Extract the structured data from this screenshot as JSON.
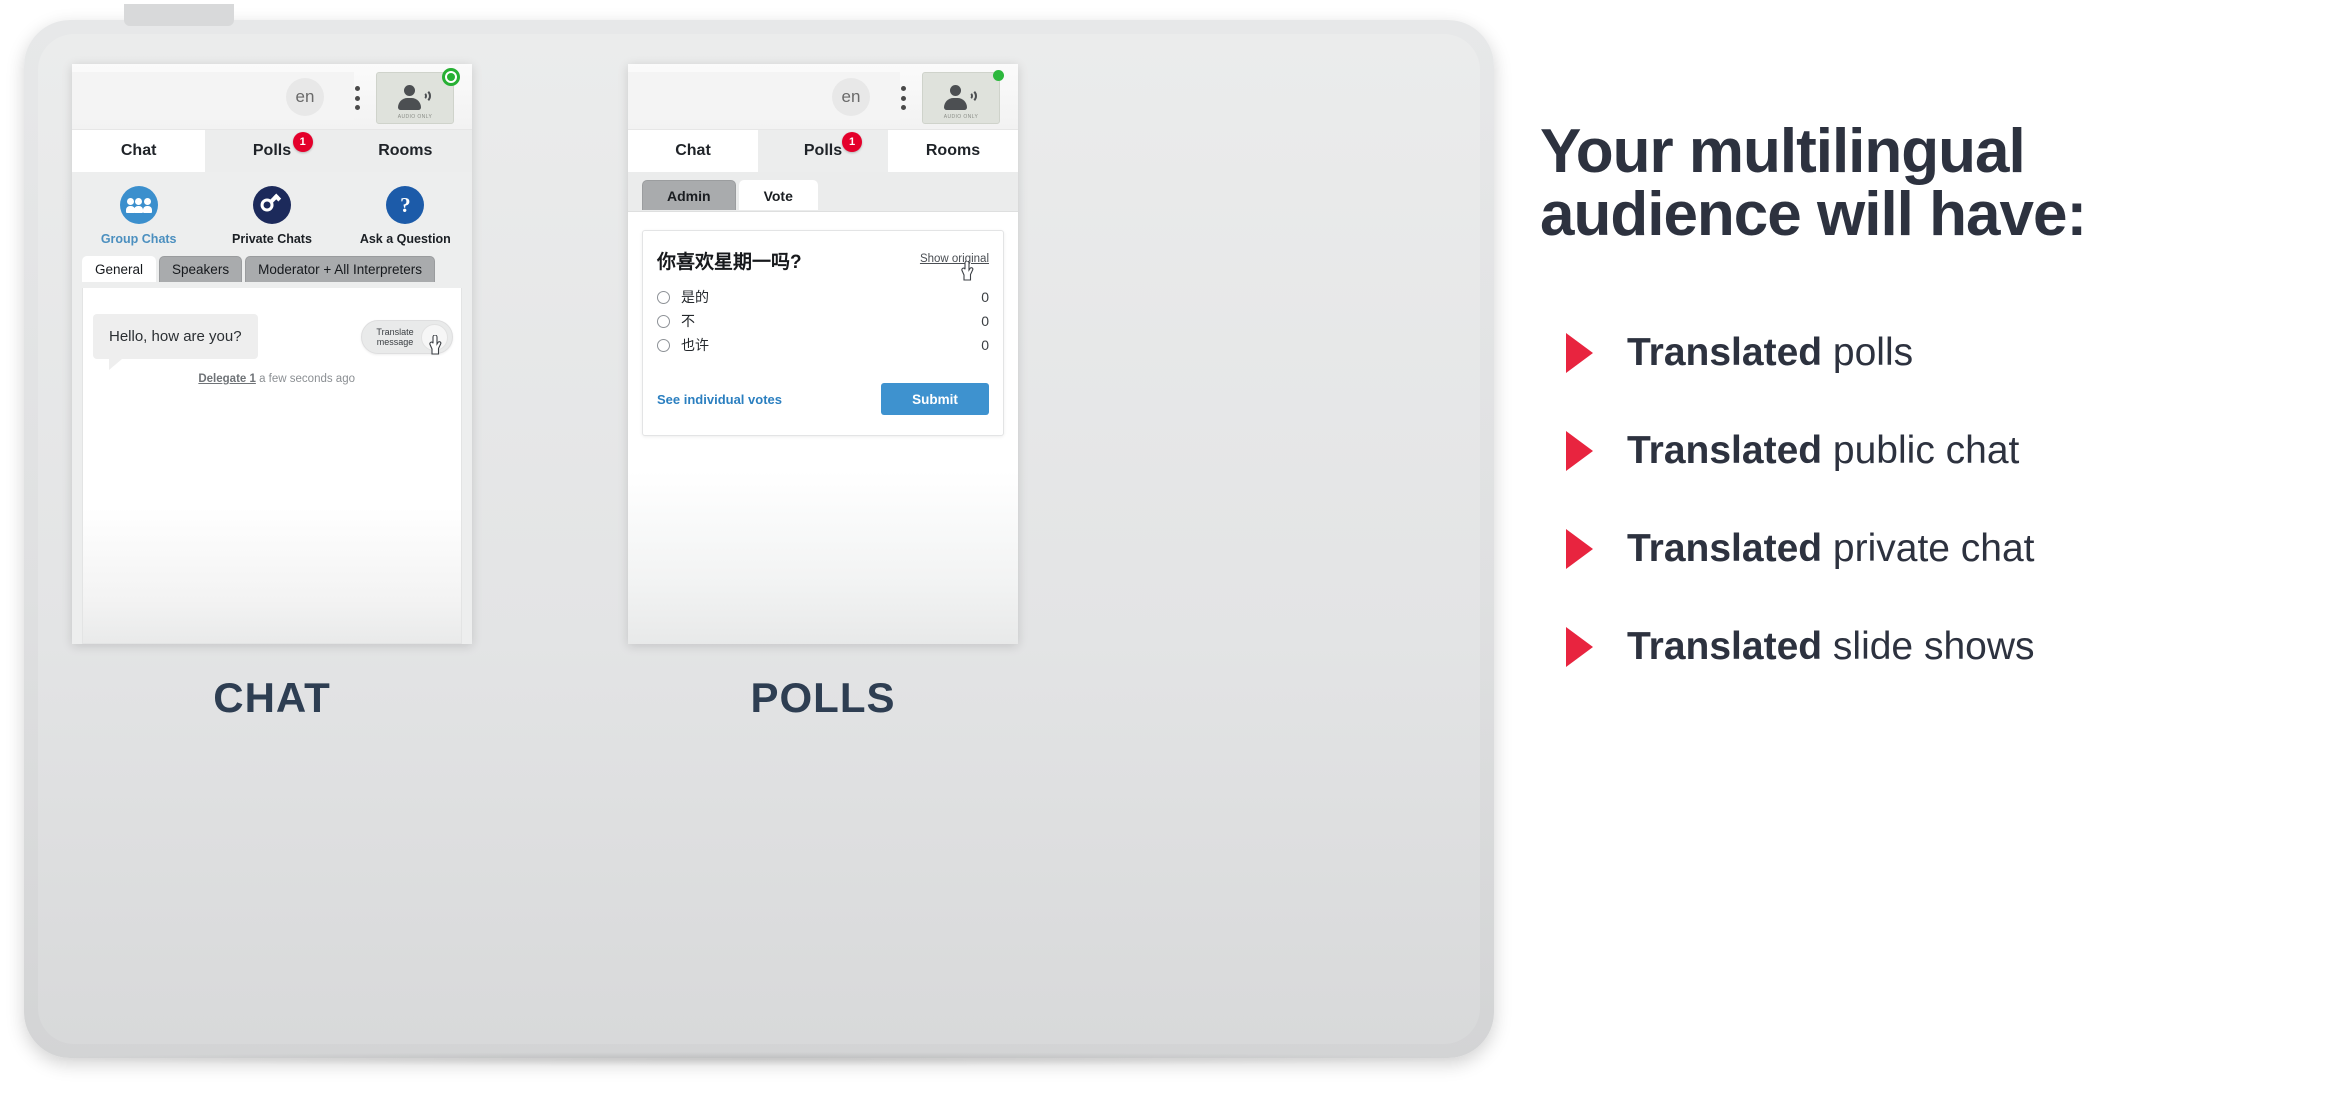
{
  "chat_app": {
    "topbar": {
      "language": "en",
      "menu_icon": "kebab-menu-icon",
      "audio_tile_label": "AUDIO ONLY",
      "status": "online"
    },
    "tabs": [
      {
        "label": "Chat",
        "active": true,
        "badge": ""
      },
      {
        "label": "Polls",
        "active": false,
        "badge": "1"
      },
      {
        "label": "Rooms",
        "active": false,
        "badge": ""
      }
    ],
    "actions": [
      {
        "label": "Group Chats",
        "icon": "group-people-icon"
      },
      {
        "label": "Private Chats",
        "icon": "key-icon"
      },
      {
        "label": "Ask a Question",
        "icon": "question-mark-icon"
      }
    ],
    "subtabs": [
      {
        "label": "General",
        "active": true
      },
      {
        "label": "Speakers",
        "active": false
      },
      {
        "label": "Moderator + All Interpreters",
        "active": false
      }
    ],
    "message": {
      "text": "Hello, how are you?",
      "author": "Delegate 1",
      "time": "a few seconds ago",
      "translate_line1": "Translate",
      "translate_line2": "message"
    },
    "caption": "CHAT"
  },
  "polls_app": {
    "topbar": {
      "language": "en",
      "menu_icon": "kebab-menu-icon",
      "audio_tile_label": "AUDIO ONLY",
      "status": "online"
    },
    "tabs": [
      {
        "label": "Chat",
        "active": false,
        "badge": ""
      },
      {
        "label": "Polls",
        "active": true,
        "badge": "1"
      },
      {
        "label": "Rooms",
        "active": false,
        "badge": ""
      }
    ],
    "subtabs": [
      {
        "label": "Admin",
        "active": false
      },
      {
        "label": "Vote",
        "active": true
      }
    ],
    "poll": {
      "question": "你喜欢星期一吗?",
      "show_original": "Show original",
      "options": [
        {
          "label": "是的",
          "votes": "0"
        },
        {
          "label": "不",
          "votes": "0"
        },
        {
          "label": "也许",
          "votes": "0"
        }
      ],
      "see_individual_votes": "See individual votes",
      "submit": "Submit"
    },
    "caption": "POLLS"
  },
  "promo": {
    "title_line1": "Your multilingual",
    "title_line2": "audience will have:",
    "items": [
      {
        "bold": "Translated",
        "rest": " polls"
      },
      {
        "bold": "Translated",
        "rest": " public chat"
      },
      {
        "bold": "Translated",
        "rest": " private chat"
      },
      {
        "bold": "Translated",
        "rest": " slide shows"
      }
    ]
  },
  "colors": {
    "accent_red": "#e8243f",
    "badge_red": "#e4002b",
    "brand_blue": "#3e92cf",
    "link_blue": "#2b7fc0",
    "dark_navy": "#2d323f",
    "online_green": "#27b034"
  }
}
